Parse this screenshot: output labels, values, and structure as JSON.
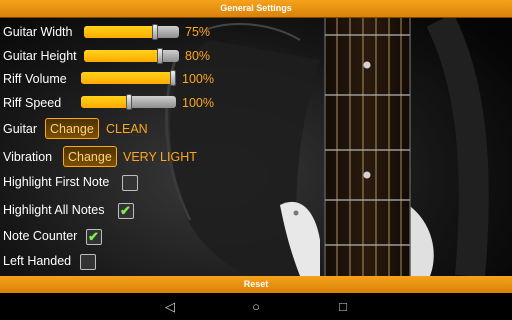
{
  "header": {
    "title": "General Settings"
  },
  "sliders": [
    {
      "label": "Guitar Width",
      "value_text": "75%",
      "level": 0.75
    },
    {
      "label": "Guitar Height",
      "value_text": "80%",
      "level": 0.8
    },
    {
      "label": "Riff Volume",
      "value_text": "100%",
      "level": 1.0
    },
    {
      "label": "Riff Speed",
      "value_text": "100%",
      "level": 0.5
    }
  ],
  "guitar": {
    "label": "Guitar",
    "button": "Change",
    "value": "CLEAN"
  },
  "vibration": {
    "label": "Vibration",
    "button": "Change",
    "value": "VERY LIGHT"
  },
  "checkboxes": [
    {
      "label": "Highlight First Note",
      "checked": false
    },
    {
      "label": "Highlight All Notes",
      "checked": true
    },
    {
      "label": "Note Counter",
      "checked": true
    },
    {
      "label": "Left Handed",
      "checked": false
    }
  ],
  "footer": {
    "reset_label": "Reset"
  },
  "navbar": {
    "back_icon": "back-icon",
    "home_icon": "home-icon",
    "recents_icon": "recents-icon"
  },
  "colors": {
    "accent": "#ffa71a",
    "check": "#7cf04b"
  }
}
